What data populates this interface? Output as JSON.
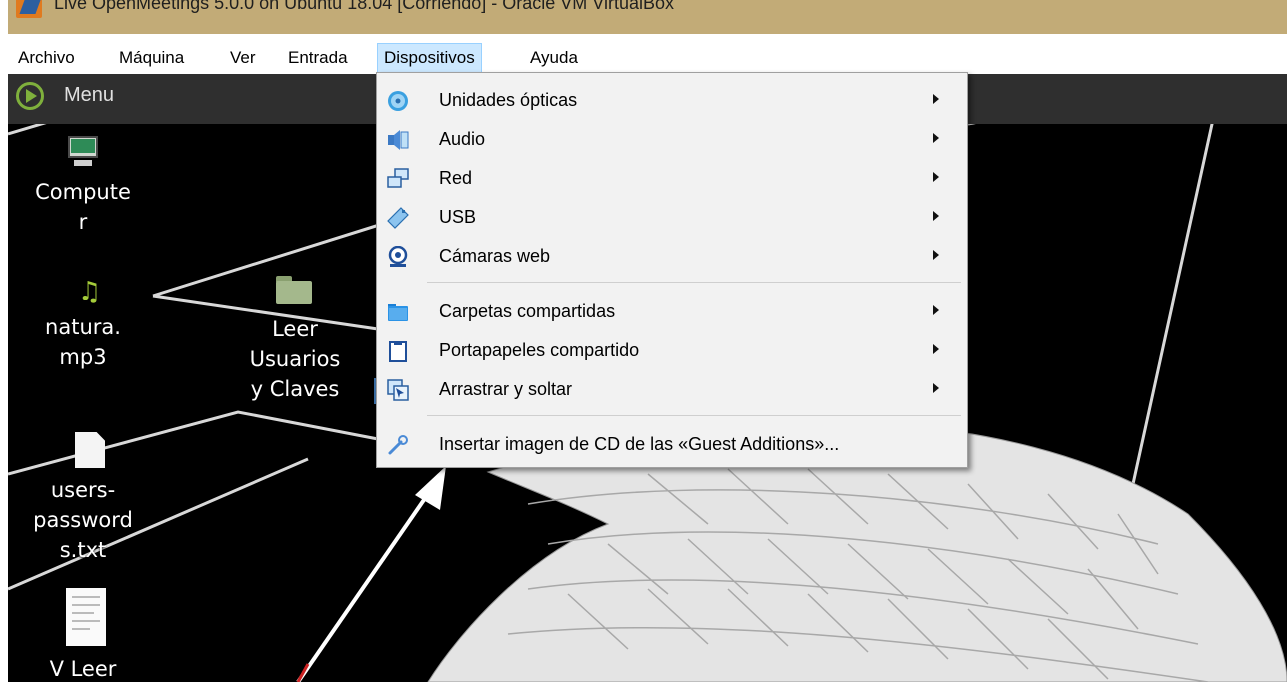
{
  "window": {
    "title": "Live OpenMeetings 5.0.0 on Ubuntu 18.04 [Corriendo] - Oracle VM VirtualBox"
  },
  "menubar": {
    "items": [
      "Archivo",
      "Máquina",
      "Ver",
      "Entrada",
      "Dispositivos",
      "Ayuda"
    ],
    "active": "Dispositivos"
  },
  "guest": {
    "panel": {
      "menu_label": "Menu"
    },
    "desktop_icons": [
      {
        "label": "Compute\nr",
        "icon": "computer-icon"
      },
      {
        "label": "natura.\nmp3",
        "icon": "music-file-icon"
      },
      {
        "label": "Leer\nUsuarios\ny Claves",
        "icon": "folder-icon"
      },
      {
        "label": "users-\npassword\ns.txt",
        "icon": "text-file-icon"
      },
      {
        "label": "V Leer",
        "icon": "document-icon"
      }
    ]
  },
  "devices_menu": {
    "items": [
      {
        "label": "Unidades ópticas",
        "icon": "optical-disc-icon",
        "submenu": true
      },
      {
        "label": "Audio",
        "icon": "audio-icon",
        "submenu": true
      },
      {
        "label": "Red",
        "icon": "network-icon",
        "submenu": true
      },
      {
        "label": "USB",
        "icon": "usb-icon",
        "submenu": true
      },
      {
        "label": "Cámaras web",
        "icon": "webcam-icon",
        "submenu": true
      },
      {
        "label": "Carpetas compartidas",
        "icon": "shared-folder-icon",
        "submenu": true
      },
      {
        "label": "Portapapeles compartido",
        "icon": "clipboard-icon",
        "submenu": true
      },
      {
        "label": "Arrastrar y soltar",
        "icon": "drag-drop-icon",
        "submenu": true
      },
      {
        "label": "Insertar imagen de CD de las «Guest Additions»...",
        "icon": "guest-additions-icon",
        "submenu": false
      }
    ]
  },
  "colors": {
    "title_bar": "#c2ab77",
    "menu_highlight": "#cce8ff",
    "desktop_bg": "#000000",
    "annotation_arrow": "#ffffff"
  }
}
